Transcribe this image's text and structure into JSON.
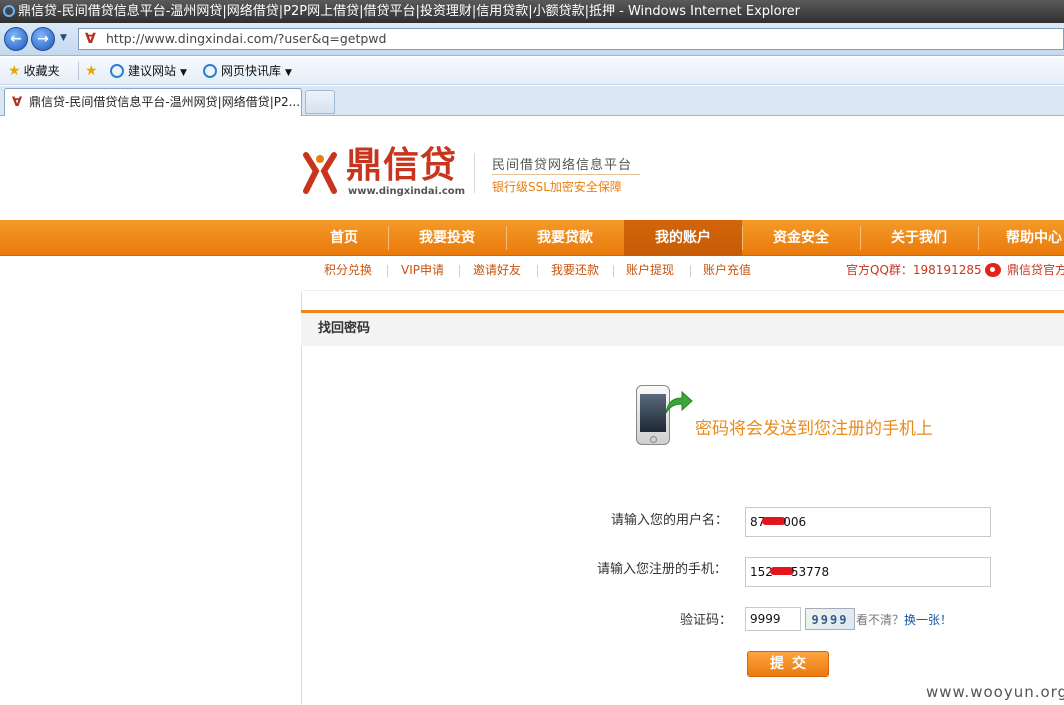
{
  "browser": {
    "window_title": "鼎信贷-民间借贷信息平台-温州网贷|网络借贷|P2P网上借贷|借贷平台|投资理财|信用贷款|小额贷款|抵押 - Windows Internet Explorer",
    "url": "http://www.dingxindai.com/?user&q=getpwd",
    "favorites_label": "收藏夹",
    "suggested_sites": "建议网站",
    "web_slices": "网页快讯库",
    "tab_title": "鼎信贷-民间借贷信息平台-温州网贷|网络借贷|P2..."
  },
  "header": {
    "logo_text": "鼎信贷",
    "logo_url": "www.dingxindai.com",
    "slogan_main": "民间借贷网络信息平台",
    "slogan_sub": "银行级SSL加密安全保障"
  },
  "main_nav": [
    {
      "label": "首页"
    },
    {
      "label": "我要投资"
    },
    {
      "label": "我要贷款"
    },
    {
      "label": "我的账户"
    },
    {
      "label": "资金安全"
    },
    {
      "label": "关于我们"
    },
    {
      "label": "帮助中心"
    }
  ],
  "sub_nav": [
    {
      "label": "积分兑换"
    },
    {
      "label": "VIP申请"
    },
    {
      "label": "邀请好友"
    },
    {
      "label": "我要还款"
    },
    {
      "label": "账户提现"
    },
    {
      "label": "账户充值"
    }
  ],
  "qq_group": "官方QQ群：198191285",
  "weibo_label": "鼎信贷官方",
  "panel": {
    "title": "找回密码",
    "message": "密码将会发送到您注册的手机上"
  },
  "form": {
    "username_label": "请输入您的用户名：",
    "username_prefix": "87",
    "username_suffix": "006",
    "phone_label": "请输入您注册的手机：",
    "phone_prefix": "152",
    "phone_suffix": "53778",
    "captcha_label": "验证码：",
    "captcha_value": "9999",
    "captcha_image_text": "9999",
    "captcha_hint": "看不清？",
    "captcha_refresh": "换一张！",
    "submit_label": "提交"
  },
  "watermark": "www.wooyun.org",
  "colors": {
    "accent_orange": "#f08519",
    "brand_red": "#c8351f",
    "active_nav": "#c75c06",
    "message_orange": "#e88b1a"
  }
}
